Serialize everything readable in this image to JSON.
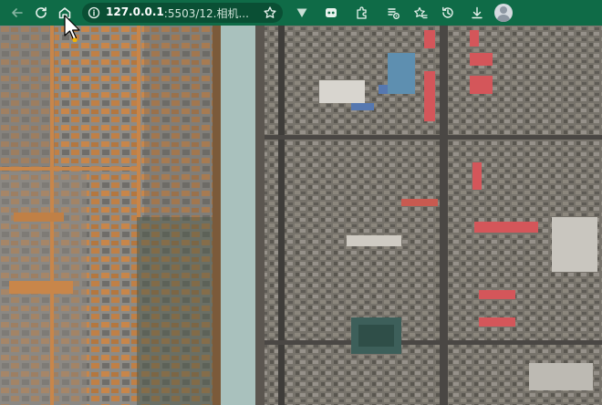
{
  "browser": {
    "url_host": "127.0.0.1",
    "url_path": ":5503/12.相机...",
    "accent_color": "#0f6b47"
  },
  "toolbar": {
    "icons": [
      "back-icon",
      "reload-icon",
      "home-icon",
      "info-icon",
      "star-icon",
      "vivaldi-icon",
      "game-icon",
      "extensions-icon",
      "media-icon",
      "favorites-icon",
      "history-icon",
      "download-icon",
      "profile-avatar"
    ]
  },
  "map": {
    "type": "satellite imagery",
    "colors": {
      "moat": "#a9c1bd",
      "roof_orange": "#c8864a",
      "roof_red": "#d4565a",
      "roof_blue": "#5678b0"
    }
  }
}
